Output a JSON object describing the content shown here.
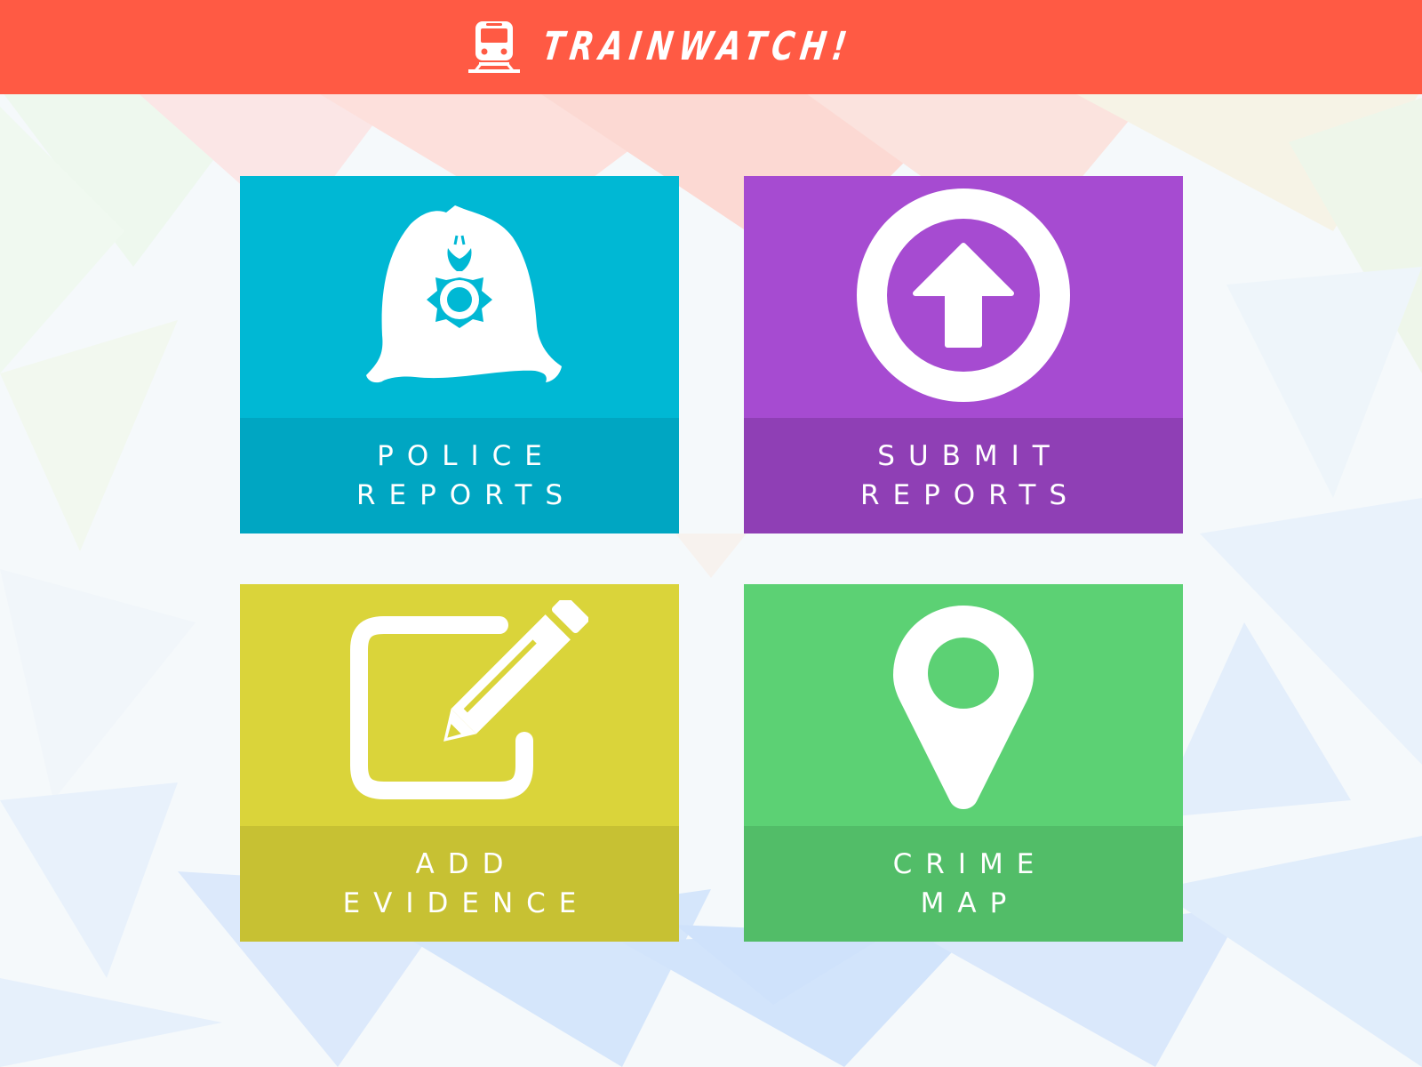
{
  "app": {
    "title": "TRAINWATCH!",
    "header_color": "#ff5a44",
    "icon": "train-icon"
  },
  "tiles": [
    {
      "id": "police-reports",
      "label_lines": [
        "POLICE",
        "REPORTS"
      ],
      "icon": "police-helmet-icon",
      "color": "#00b8d4",
      "label_bg": "#00a6c2"
    },
    {
      "id": "submit-reports",
      "label_lines": [
        "SUBMIT",
        "REPORTS"
      ],
      "icon": "upload-arrow-icon",
      "color": "#a64bd1",
      "label_bg": "#8f3fb5"
    },
    {
      "id": "add-evidence",
      "label_lines": [
        "ADD",
        "EVIDENCE"
      ],
      "icon": "edit-pencil-icon",
      "color": "#dad43a",
      "label_bg": "#c7c133"
    },
    {
      "id": "crime-map",
      "label_lines": [
        "CRIME",
        "MAP"
      ],
      "icon": "map-pin-icon",
      "color": "#5cd174",
      "label_bg": "#52bd68"
    }
  ]
}
